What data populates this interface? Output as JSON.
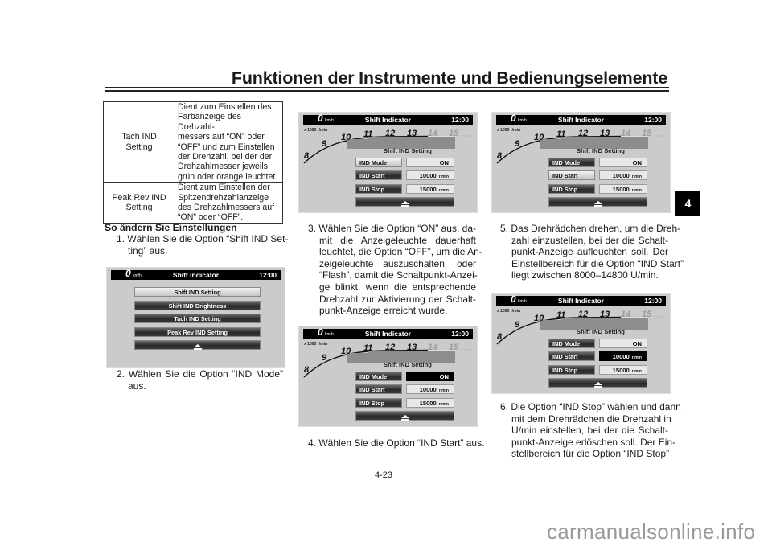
{
  "header": {
    "title": "Funktionen der Instrumente und Bedienungselemente",
    "chapter_tab": "4"
  },
  "footer": {
    "page_number": "4-23",
    "watermark": "carmanualsonline.info"
  },
  "table": {
    "rows": [
      {
        "key_lines": [
          "Tach IND",
          "Setting"
        ],
        "value_lines": [
          "Dient zum Einstellen des",
          "Farbanzeige des Drehzahl-",
          "messers auf “ON” oder",
          "“OFF” und zum Einstellen",
          "der Drehzahl, bei der der",
          "Drehzahlmesser jeweils",
          "grün oder orange leuchtet."
        ]
      },
      {
        "key_lines": [
          "Peak Rev IND",
          "Setting"
        ],
        "value_lines": [
          "Dient zum Einstellen der",
          "Spitzendrehzahlanzeige",
          "des Drehzahlmessers auf",
          "“ON” oder “OFF”."
        ]
      }
    ]
  },
  "section_heading": "So ändern Sie Einstellungen",
  "steps": [
    {
      "lines": [
        "1. Wählen Sie die Option “Shift IND Set-",
        "ting” aus."
      ]
    },
    {
      "lines": [
        "2. Wählen Sie die Option “IND Mode”",
        "aus."
      ]
    },
    {
      "lines": [
        "3. Wählen Sie die Option “ON” aus, da-",
        "mit die Anzeigeleuchte dauerhaft",
        "leuchtet, die Option “OFF”, um die An-",
        "zeigeleuchte auszuschalten, oder",
        "“Flash”, damit die Schaltpunkt-Anzei-",
        "ge blinkt, wenn die entsprechende",
        "Drehzahl zur Aktivierung der Schalt-",
        "punkt-Anzeige erreicht wurde."
      ]
    },
    {
      "lines": [
        "4. Wählen Sie die Option “IND Start” aus."
      ]
    },
    {
      "lines": [
        "5. Das Drehrädchen drehen, um die Dreh-",
        "zahl einzustellen, bei der die Schalt-",
        "punkt-Anzeige aufleuchten soll. Der",
        "Einstellbereich für die Option “IND Start”",
        "liegt zwischen 8000–14800 U/min."
      ]
    },
    {
      "lines": [
        "6. Die Option “IND Stop” wählen und dann",
        "mit dem Drehrädchen die Drehzahl in",
        "U/min einstellen, bei der die Schalt-",
        "punkt-Anzeige erlöschen soll. Der Ein-",
        "stellbereich für die Option “IND Stop”"
      ]
    }
  ],
  "screens": [
    {
      "kind": "menu",
      "speed": "0",
      "speed_unit": "km/h",
      "title": "Shift Indicator",
      "clock": "12:00",
      "items": [
        "Shift IND Setting",
        "Shift IND Brightness",
        "Tach IND Setting",
        "Peak Rev IND Setting"
      ],
      "selected_item": 0,
      "back_icon": "eject-icon"
    },
    {
      "kind": "setting",
      "speed": "0",
      "speed_unit": "km/h",
      "title": "Shift Indicator",
      "clock": "12:00",
      "scale_label": "x 1000 r/min",
      "scale_numbers": [
        "8",
        "9",
        "10",
        "11",
        "12",
        "13",
        "14",
        "15"
      ],
      "dimmed_numbers": [
        "14",
        "15"
      ],
      "subtitle": "Shift IND Setting",
      "rows": [
        {
          "label": "IND Mode",
          "value": "ON",
          "unit": ""
        },
        {
          "label": "IND Start",
          "value": "10000",
          "unit": "r/min"
        },
        {
          "label": "IND Stop",
          "value": "15000",
          "unit": "r/min"
        }
      ],
      "selected_label": 0,
      "active_value": null,
      "back_icon": "eject-icon"
    },
    {
      "kind": "setting",
      "speed": "0",
      "speed_unit": "km/h",
      "title": "Shift Indicator",
      "clock": "12:00",
      "scale_label": "x 1000 r/min",
      "scale_numbers": [
        "8",
        "9",
        "10",
        "11",
        "12",
        "13",
        "14",
        "15"
      ],
      "dimmed_numbers": [
        "14",
        "15"
      ],
      "subtitle": "Shift IND Setting",
      "rows": [
        {
          "label": "IND Mode",
          "value": "ON",
          "unit": ""
        },
        {
          "label": "IND Start",
          "value": "10000",
          "unit": "r/min"
        },
        {
          "label": "IND Stop",
          "value": "15000",
          "unit": "r/min"
        }
      ],
      "selected_label": null,
      "active_value": 0,
      "back_icon": "eject-icon"
    },
    {
      "kind": "setting",
      "speed": "0",
      "speed_unit": "km/h",
      "title": "Shift Indicator",
      "clock": "12:00",
      "scale_label": "x 1000 r/min",
      "scale_numbers": [
        "8",
        "9",
        "10",
        "11",
        "12",
        "13",
        "14",
        "15"
      ],
      "dimmed_numbers": [
        "14",
        "15"
      ],
      "subtitle": "Shift IND Setting",
      "rows": [
        {
          "label": "IND Mode",
          "value": "ON",
          "unit": ""
        },
        {
          "label": "IND Start",
          "value": "10000",
          "unit": "r/min"
        },
        {
          "label": "IND Stop",
          "value": "15000",
          "unit": "r/min"
        }
      ],
      "selected_label": 1,
      "active_value": null,
      "back_icon": "eject-icon"
    },
    {
      "kind": "setting",
      "speed": "0",
      "speed_unit": "km/h",
      "title": "Shift Indicator",
      "clock": "12:00",
      "scale_label": "x 1000 r/min",
      "scale_numbers": [
        "8",
        "9",
        "10",
        "11",
        "12",
        "13",
        "14",
        "15"
      ],
      "dimmed_numbers": [
        "14",
        "15"
      ],
      "subtitle": "Shift IND Setting",
      "rows": [
        {
          "label": "IND Mode",
          "value": "ON",
          "unit": ""
        },
        {
          "label": "IND Start",
          "value": "10000",
          "unit": "r/min"
        },
        {
          "label": "IND Stop",
          "value": "15000",
          "unit": "r/min"
        }
      ],
      "selected_label": null,
      "active_value": 1,
      "back_icon": "eject-icon"
    }
  ]
}
